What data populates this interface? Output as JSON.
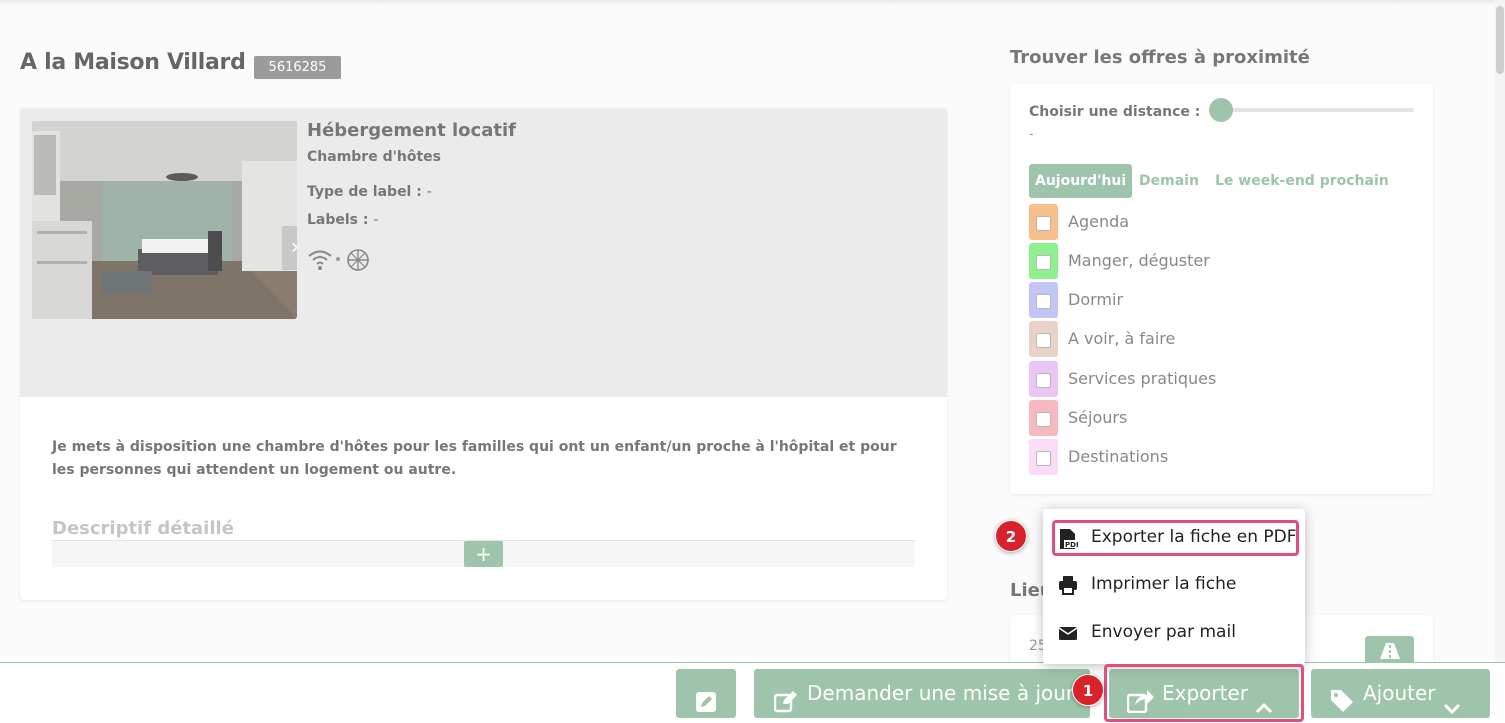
{
  "listing": {
    "title": "A la Maison Villard",
    "id": "5616285",
    "category": "Hébergement locatif",
    "subcategory": "Chambre d'hôtes",
    "label_type_key": "Type de label :",
    "label_type_value": "-",
    "labels_key": "Labels :",
    "labels_value": "-",
    "amenities": [
      "wifi-icon",
      "accessibility-icon"
    ],
    "description": "Je mets à disposition une chambre d'hôtes pour les familles qui ont un enfant/un proche à l'hôpital et pour les personnes qui attendent un logement ou autre.",
    "detail_heading": "Descriptif détaillé",
    "add_label": "+"
  },
  "nearby": {
    "title": "Trouver les offres à proximité",
    "distance_label": "Choisir une distance :",
    "distance_value": "-",
    "days": [
      {
        "label": "Aujourd'hui",
        "active": true
      },
      {
        "label": "Demain",
        "active": false
      },
      {
        "label": "Le week-end prochain",
        "active": false
      }
    ],
    "categories": [
      {
        "label": "Agenda",
        "color": "#f7c08a"
      },
      {
        "label": "Manger, déguster",
        "color": "#8ef08e"
      },
      {
        "label": "Dormir",
        "color": "#c3c6f5"
      },
      {
        "label": "A voir, à faire",
        "color": "#e9d3c6"
      },
      {
        "label": "Services pratiques",
        "color": "#e9c6f5"
      },
      {
        "label": "Séjours",
        "color": "#f5b9c0"
      },
      {
        "label": "Destinations",
        "color": "#fadcf7"
      }
    ]
  },
  "location": {
    "title": "Lieu",
    "address_start": "25"
  },
  "export_menu": {
    "items": [
      {
        "label": "Exporter la fiche en PDF",
        "icon": "pdf-icon"
      },
      {
        "label": "Imprimer la fiche",
        "icon": "printer-icon"
      },
      {
        "label": "Envoyer par mail",
        "icon": "envelope-icon"
      }
    ]
  },
  "toolbar": {
    "edit_icon": "edit-icon",
    "request_update": "Demander une mise à jour",
    "export": "Exporter",
    "add": "Ajouter"
  },
  "annotations": {
    "step1": "1",
    "step2": "2",
    "highlight_color": "#e0507a"
  }
}
